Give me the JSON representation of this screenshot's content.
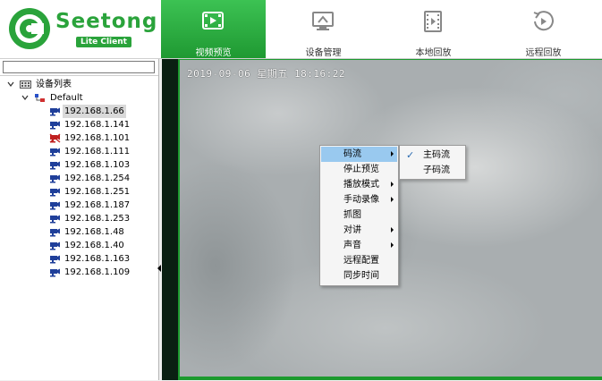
{
  "brand": {
    "name": "Seetong",
    "badge": "Lite Client"
  },
  "nav": [
    {
      "label": "视频预览",
      "icon": "video-preview-icon",
      "active": true
    },
    {
      "label": "设备管理",
      "icon": "device-management-icon",
      "active": false
    },
    {
      "label": "本地回放",
      "icon": "local-playback-icon",
      "active": false
    },
    {
      "label": "远程回放",
      "icon": "remote-playback-icon",
      "active": false
    }
  ],
  "search": {
    "value": ""
  },
  "tree": {
    "root": "设备列表",
    "group": "Default",
    "devices": [
      {
        "ip": "192.168.1.66",
        "status": "online"
      },
      {
        "ip": "192.168.1.141",
        "status": "online"
      },
      {
        "ip": "192.168.1.101",
        "status": "offline"
      },
      {
        "ip": "192.168.1.111",
        "status": "online"
      },
      {
        "ip": "192.168.1.103",
        "status": "online"
      },
      {
        "ip": "192.168.1.254",
        "status": "online"
      },
      {
        "ip": "192.168.1.251",
        "status": "online"
      },
      {
        "ip": "192.168.1.187",
        "status": "online"
      },
      {
        "ip": "192.168.1.253",
        "status": "online"
      },
      {
        "ip": "192.168.1.48",
        "status": "online"
      },
      {
        "ip": "192.168.1.40",
        "status": "online"
      },
      {
        "ip": "192.168.1.163",
        "status": "online"
      },
      {
        "ip": "192.168.1.109",
        "status": "online"
      }
    ]
  },
  "video": {
    "timestamp": "2019-09-06 星期五 18:16:22"
  },
  "context_menu": {
    "items": [
      "码流",
      "停止预览",
      "播放模式",
      "手动录像",
      "抓图",
      "对讲",
      "声音",
      "远程配置",
      "同步时间"
    ],
    "submenu": [
      "主码流",
      "子码流"
    ]
  },
  "colors": {
    "brand_green": "#2aa33b",
    "menu_highlight": "#99c9ef"
  }
}
